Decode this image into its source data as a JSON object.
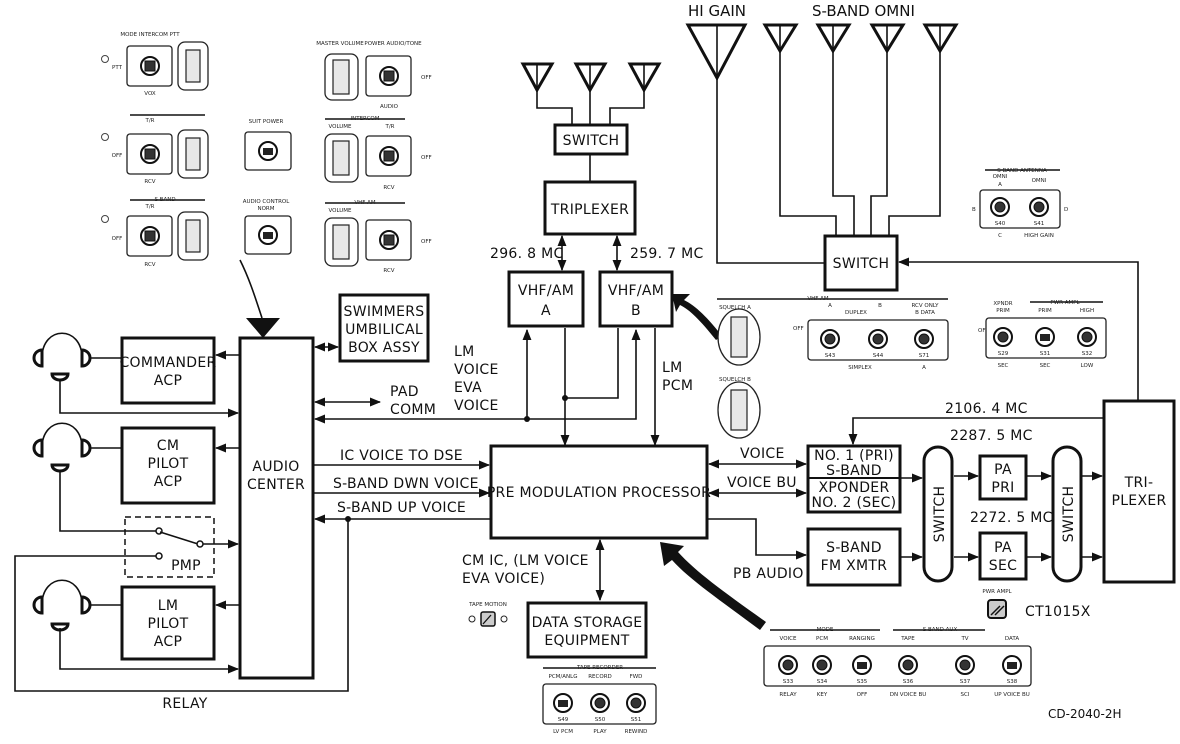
{
  "diagram": {
    "title_code": "CD-2040-2H",
    "sub_code": "CT1015X",
    "antennas": {
      "hi_gain_label": "HI GAIN",
      "sband_omni_label": "S-BAND OMNI"
    },
    "blocks": {
      "vhf_switch": "SWITCH",
      "vhf_triplexer": "TRIPLEXER",
      "vhf_a": [
        "VHF/AM",
        "A"
      ],
      "vhf_b": [
        "VHF/AM",
        "B"
      ],
      "sband_switch": "SWITCH",
      "swimmers": [
        "SWIMMERS",
        "UMBILICAL",
        "BOX ASSY"
      ],
      "commander_acp": [
        "COMMANDER",
        "ACP"
      ],
      "cm_pilot_acp": [
        "CM",
        "PILOT",
        "ACP"
      ],
      "lm_pilot_acp": [
        "LM",
        "PILOT",
        "ACP"
      ],
      "audio_center": [
        "AUDIO",
        "CENTER"
      ],
      "pmp": "PMP",
      "pmp_processor": "PRE MODULATION PROCESSOR",
      "data_storage": [
        "DATA STORAGE",
        "EQUIPMENT"
      ],
      "xponder": [
        "NO. 1 (PRI)",
        "S-BAND",
        "XPONDER",
        "NO. 2 (SEC)"
      ],
      "fm_xmtr": [
        "S-BAND",
        "FM XMTR"
      ],
      "switch_1": "SWITCH",
      "switch_2": "SWITCH",
      "pa_pri": [
        "PA",
        "PRI"
      ],
      "pa_sec": [
        "PA",
        "SEC"
      ],
      "triplexer_sband": [
        "TRI-",
        "PLEXER"
      ]
    },
    "signals": {
      "freq_a": "296. 8 MC",
      "freq_b": "259. 7 MC",
      "freq_uplink": "2106. 4 MC",
      "freq_pri": "2287. 5 MC",
      "freq_sec": "2272. 5 MC",
      "lm_voice_eva": [
        "LM",
        "VOICE",
        "EVA",
        "VOICE"
      ],
      "lm_pcm": [
        "LM",
        "PCM"
      ],
      "pad_comm": [
        "PAD",
        "COMM"
      ],
      "ic_voice_dse": "IC VOICE TO DSE",
      "sband_dwn": "S-BAND DWN VOICE",
      "sband_up": "S-BAND UP VOICE",
      "cm_ic": [
        "CM IC, (LM VOICE",
        "EVA VOICE)"
      ],
      "voice": "VOICE",
      "voice_bu": "VOICE BU",
      "pb_audio": "PB AUDIO",
      "relay": "RELAY"
    },
    "panels": {
      "acp_mode": {
        "header": "MODE INTERCOM PTT",
        "left": "PTT",
        "bottom": "VOX"
      },
      "acp_vhf": {
        "header": "T/R",
        "left": "OFF",
        "bottom": "RCV"
      },
      "acp_sband": {
        "group": "S BAND",
        "header": "T/R",
        "left": "OFF",
        "bottom": "RCV"
      },
      "suit_power": "SUIT POWER",
      "audio_control": [
        "AUDIO CONTROL",
        "NORM"
      ],
      "master_volume": "MASTER VOLUME",
      "power_audio_tone": {
        "header": "POWER AUDIO/TONE",
        "right": "OFF",
        "bottom": "AUDIO"
      },
      "intercom": {
        "group": "INTERCOM",
        "vol": "VOLUME",
        "header": "T/R",
        "right": "OFF",
        "bottom": "RCV"
      },
      "vhf_am": {
        "group": "VHF AM",
        "vol": "VOLUME",
        "right": "OFF",
        "bottom": "RCV"
      },
      "sband_antenna": {
        "group": "S BAND ANTENNA",
        "omni_a": [
          "OMNI",
          "A"
        ],
        "omni": "OMNI",
        "b": "B",
        "c": "C",
        "d": "D",
        "s40": "S40",
        "s41": "S41",
        "high_gain": "HIGH GAIN"
      },
      "vhf_am_panel": {
        "group": "VHF AM",
        "a": "A",
        "b": "B",
        "duplex": "DUPLEX",
        "rcv_only": [
          "RCV ONLY",
          "B DATA"
        ],
        "off": "OFF",
        "s43": "S43",
        "s44": "S44",
        "s71": "S71",
        "simplex": "SIMPLEX",
        "a2": "A"
      },
      "squelch_a": "SQUELCH A",
      "squelch_b": "SQUELCH B",
      "pwr_ampl": {
        "xpndr": [
          "XPNDR",
          "PRIM"
        ],
        "group": "PWR AMPL",
        "prim": "PRIM",
        "high": "HIGH",
        "off": "OFF",
        "s29": "S29",
        "s31": "S31",
        "s32": "S32",
        "sec1": "SEC",
        "sec2": "SEC",
        "low": "LOW"
      },
      "pwr_ampl_light": "PWR AMPL",
      "tape_motion": "TAPE MOTION",
      "tape_recorder": {
        "group": "TAPE RECORDER",
        "pcm": "PCM/ANLG",
        "record": "RECORD",
        "fwd": "FWD",
        "s49": "S49",
        "s50": "S50",
        "s51": "S51",
        "lv": "LV PCM",
        "play": "PLAY",
        "rewind": "REWIND"
      },
      "mode_aux": {
        "mode": "MODE",
        "aux": "S BAND AUX",
        "voice": "VOICE",
        "pcm": "PCM",
        "ranging": "RANGING",
        "tape": "TAPE",
        "tv": "TV",
        "data": "DATA",
        "s33": "S33",
        "s34": "S34",
        "s35": "S35",
        "s36": "S36",
        "s37": "S37",
        "s38": "S38",
        "relay": "RELAY",
        "key": "KEY",
        "off": "OFF",
        "dn": "DN VOICE BU",
        "sci": "SCI",
        "up": "UP VOICE BU"
      }
    }
  }
}
